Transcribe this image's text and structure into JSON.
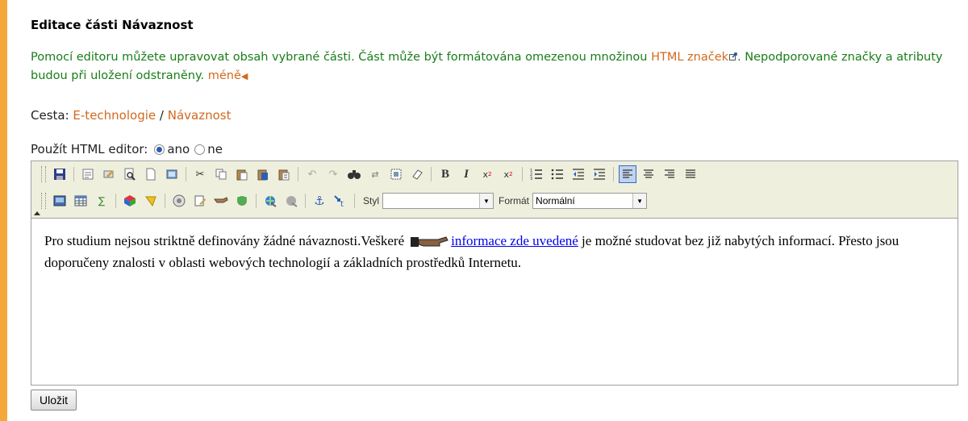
{
  "section_title": "Editace části Návaznost",
  "help": {
    "text_before": "Pomocí editoru můžete upravovat obsah vybrané části. Část může být formátována omezenou množinou ",
    "html_link": "HTML značek",
    "text_after": ". Nepodporované značky a atributy budou při uložení odstraněny. ",
    "less_link": "méně"
  },
  "path": {
    "label": "Cesta: ",
    "crumbs": [
      "E-technologie",
      "Návaznost"
    ],
    "separator": " / "
  },
  "editor_toggle": {
    "label": "Použít HTML editor:",
    "option_yes": "ano",
    "option_no": "ne",
    "selected": "ano"
  },
  "toolbar": {
    "style_label": "Styl",
    "style_value": "",
    "format_label": "Formát",
    "format_value": "Normální"
  },
  "content": {
    "text1": "Pro studium nejsou striktně definovány žádné návaznosti.Veškeré",
    "link": "informace zde uvedené",
    "text2": " je možné studovat bez již nabytých informací. Přesto jsou doporučeny znalosti v oblasti webových technologií a základních prostředků Internetu."
  },
  "save_label": "Uložit",
  "colors": {
    "accent_bar": "#f5a83a",
    "help_text": "#1a7d1a",
    "link": "#d2691e",
    "toolbar_bg": "#efefde"
  }
}
